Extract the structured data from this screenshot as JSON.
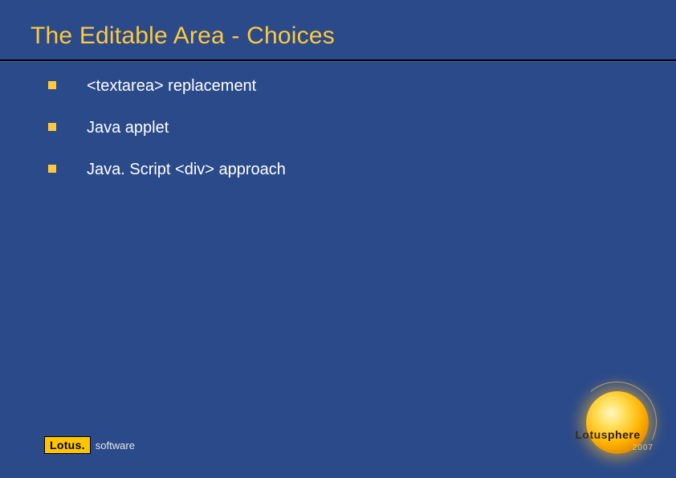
{
  "title": "The Editable Area - Choices",
  "bullets": [
    "<textarea> replacement",
    "Java applet",
    "Java. Script <div> approach"
  ],
  "footer": {
    "lotus_mark": "Lotus.",
    "lotus_software": "software"
  },
  "logo": {
    "brand_a": "Lotus",
    "brand_b": "phere",
    "year": "2007"
  }
}
